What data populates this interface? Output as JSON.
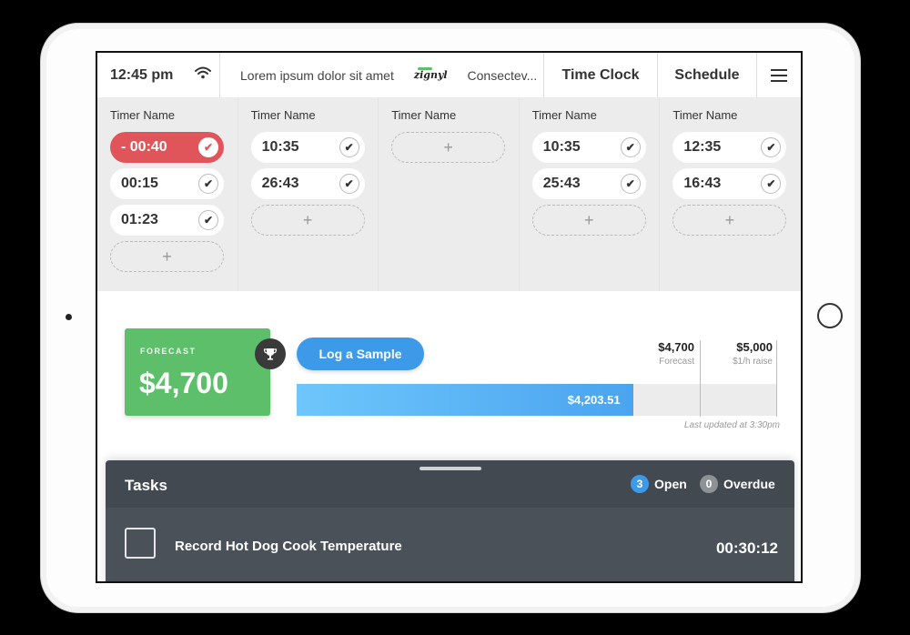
{
  "status": {
    "time": "12:45 pm"
  },
  "ticker": {
    "text1": "Lorem ipsum dolor sit amet",
    "logo": "zignyl",
    "text2": "Consectev..."
  },
  "nav": {
    "timeclock_label": "Time Clock",
    "schedule_label": "Schedule"
  },
  "timer_columns": [
    {
      "label": "Timer Name",
      "timers": [
        {
          "value": "- 00:40",
          "state": "alert"
        },
        {
          "value": "00:15"
        },
        {
          "value": "01:23"
        }
      ]
    },
    {
      "label": "Timer Name",
      "timers": [
        {
          "value": "10:35"
        },
        {
          "value": "26:43"
        }
      ]
    },
    {
      "label": "Timer Name",
      "timers": []
    },
    {
      "label": "Timer Name",
      "timers": [
        {
          "value": "10:35"
        },
        {
          "value": "25:43"
        }
      ]
    },
    {
      "label": "Timer Name",
      "timers": [
        {
          "value": "12:35"
        },
        {
          "value": "16:43"
        }
      ]
    }
  ],
  "add_symbol": "+",
  "forecast": {
    "label": "FORECAST",
    "value": "$4,700"
  },
  "log_button": "Log a Sample",
  "goals": [
    {
      "value": "$4,700",
      "label": "Forecast"
    },
    {
      "value": "$5,000",
      "label": "$1/h raise"
    }
  ],
  "progress": {
    "value": "$4,203.51",
    "fraction": 0.7
  },
  "last_updated": "Last updated at 3:30pm",
  "tasks": {
    "title": "Tasks",
    "open_count": "3",
    "open_label": "Open",
    "overdue_count": "0",
    "overdue_label": "Overdue",
    "items": [
      {
        "name": "Record Hot Dog Cook Temperature",
        "time": "00:30:12"
      }
    ]
  },
  "colors": {
    "alert": "#e0555a",
    "accent": "#3d9ae8",
    "forecast": "#5dbf6a",
    "panel": "#424950"
  }
}
